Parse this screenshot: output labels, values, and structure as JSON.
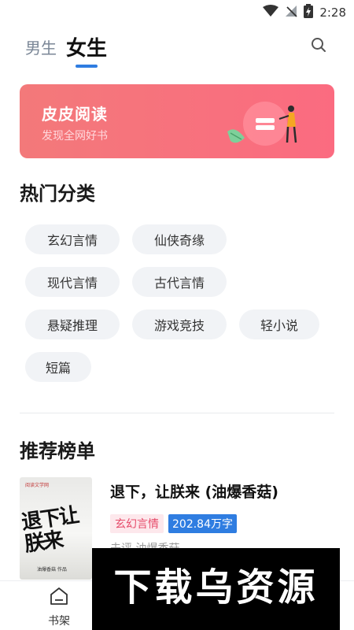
{
  "status_bar": {
    "time": "2:28",
    "icons": [
      "wifi-icon",
      "no-signal-icon",
      "battery-charging-icon"
    ]
  },
  "top_tabs": {
    "male": "男生",
    "female": "女生",
    "active": "female"
  },
  "search": {
    "icon": "search-icon"
  },
  "banner": {
    "title": "皮皮阅读",
    "subtitle": "发现全网好书"
  },
  "hot_categories": {
    "title": "热门分类",
    "items": [
      "玄幻言情",
      "仙侠奇缘",
      "现代言情",
      "古代言情",
      "悬疑推理",
      "游戏竞技",
      "轻小说",
      "短篇"
    ]
  },
  "recommend": {
    "title": "推荐榜单",
    "books": [
      {
        "title": "退下，让朕来 (油爆香菇)",
        "genre": "玄幻言情",
        "word_count": "202.84万字",
        "meta": "未评 油爆香菇",
        "cover": {
          "publisher": "阅读文学网",
          "title": "退下让朕来",
          "author": "油爆香菇 作品"
        }
      }
    ]
  },
  "bottom_nav": {
    "items": [
      {
        "label": "书架",
        "icon": "bookshelf-icon"
      }
    ]
  },
  "watermark": {
    "text": "下载乌资源"
  },
  "colors": {
    "accent": "#2f7de1",
    "banner": "#f7707d",
    "genre_tag": "#e64b6a"
  }
}
